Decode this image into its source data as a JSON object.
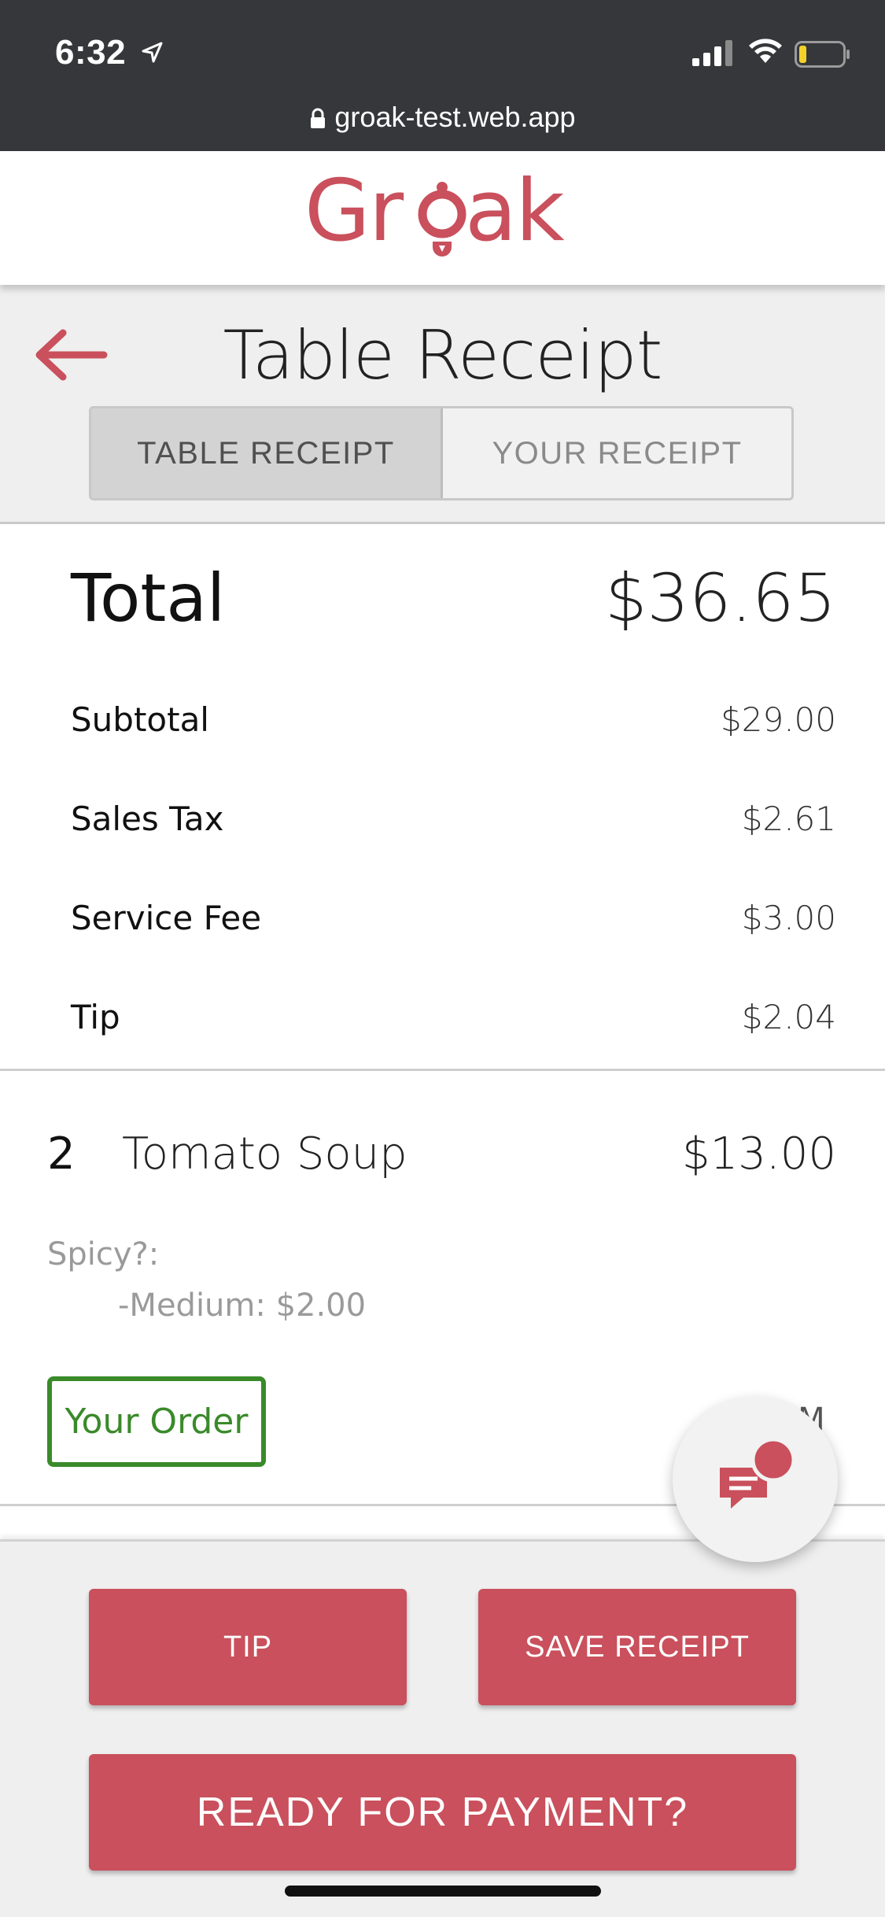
{
  "status_bar": {
    "time": "6:32",
    "url": "groak-test.web.app"
  },
  "header": {
    "logo_text": "Groak",
    "brand_color": "#c9505c"
  },
  "title_area": {
    "title": "Table Receipt",
    "tabs": [
      {
        "label": "TABLE RECEIPT",
        "active": true
      },
      {
        "label": "YOUR RECEIPT",
        "active": false
      }
    ]
  },
  "totals": {
    "total_label": "Total",
    "total_value": "$36.65",
    "lines": [
      {
        "label": "Subtotal",
        "value": "$29.00"
      },
      {
        "label": "Sales Tax",
        "value": "$2.61"
      },
      {
        "label": "Service Fee",
        "value": "$3.00"
      },
      {
        "label": "Tip",
        "value": "$2.04"
      }
    ]
  },
  "items": [
    {
      "qty": "2",
      "name": "Tomato Soup",
      "price": "$13.00",
      "modifier_title": "Spicy?:",
      "modifier_option": "-Medium: $2.00",
      "badge": "Your Order",
      "time_partial": "PM"
    }
  ],
  "actions": {
    "tip": "TIP",
    "save_receipt": "SAVE RECEIPT",
    "ready_for_payment": "READY FOR PAYMENT?"
  },
  "icons": {
    "back": "arrow-left-icon",
    "chat": "chat-bubbles-icon",
    "lock": "lock-icon"
  }
}
